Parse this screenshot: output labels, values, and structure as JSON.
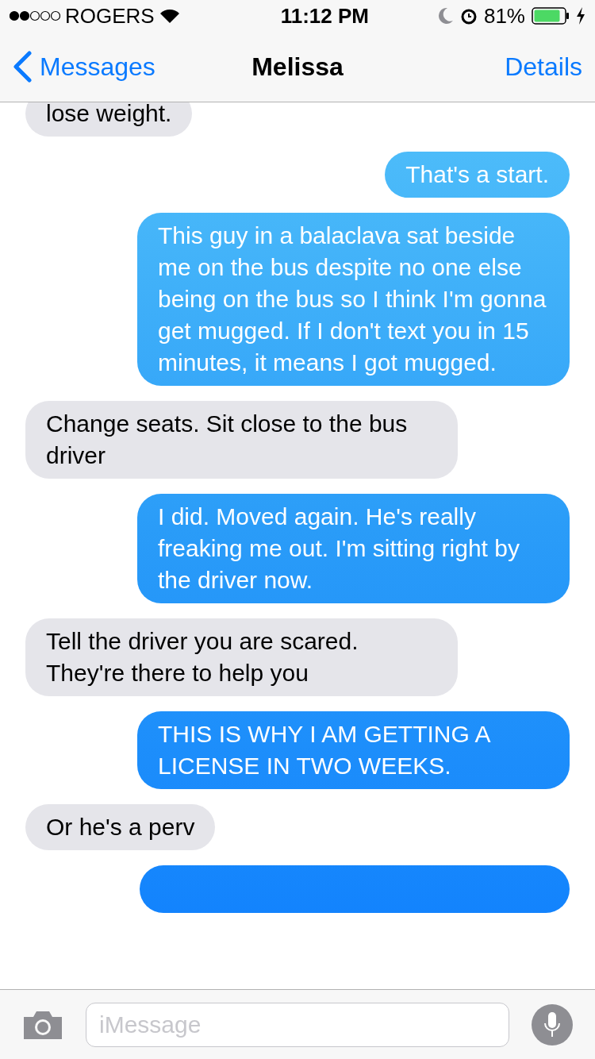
{
  "status_bar": {
    "carrier": "ROGERS",
    "time": "11:12 PM",
    "battery": "81%"
  },
  "nav": {
    "back": "Messages",
    "title": "Melissa",
    "action": "Details"
  },
  "messages": [
    {
      "kind": "received",
      "text": "lose weight."
    },
    {
      "kind": "sent",
      "text": "That's a start."
    },
    {
      "kind": "sent",
      "text": "This guy in a balaclava sat beside me on the bus despite no one else being on the bus so I think I'm gonna get mugged. If I don't text you in 15 minutes, it means I got mugged."
    },
    {
      "kind": "received",
      "text": "Change seats. Sit close to the bus driver"
    },
    {
      "kind": "sent",
      "text": "I did. Moved again. He's really freaking me out. I'm sitting right by the driver now."
    },
    {
      "kind": "received",
      "text": "Tell the driver you are scared. They're there to help you"
    },
    {
      "kind": "sent",
      "text": "THIS IS WHY I AM GETTING A LICENSE IN TWO WEEKS."
    },
    {
      "kind": "received",
      "text": "Or he's a perv"
    },
    {
      "kind": "sent"
    }
  ],
  "input": {
    "placeholder": "iMessage"
  }
}
